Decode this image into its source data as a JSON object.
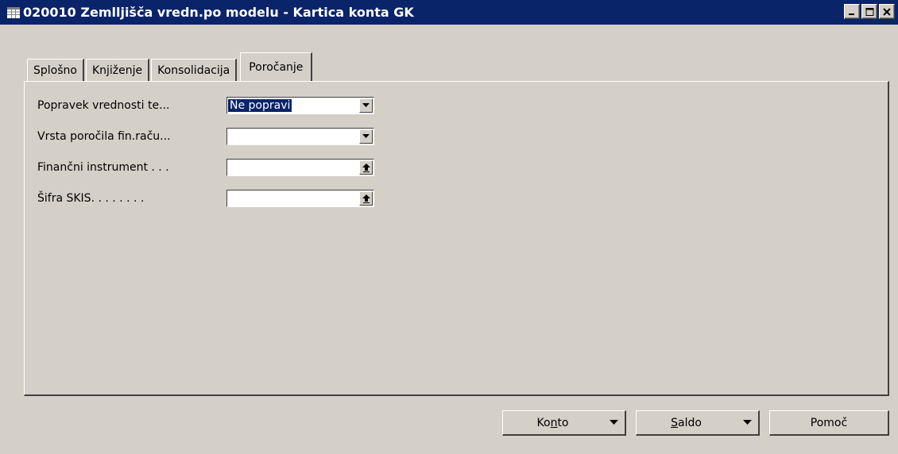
{
  "window": {
    "title": "020010 Zemlljišča vredn.po modelu - Kartica konta GK",
    "controls": [
      "minimize-icon",
      "maximize-icon",
      "close-icon"
    ]
  },
  "tabs": [
    {
      "label": "Splošno",
      "active": false
    },
    {
      "label": "Knjiženje",
      "active": false
    },
    {
      "label": "Konsolidacija",
      "active": false
    },
    {
      "label": "Poročanje",
      "active": true
    }
  ],
  "fields": [
    {
      "label": "Popravek vrednosti te...",
      "value": "Ne popravi",
      "control": "dropdown"
    },
    {
      "label": "Vrsta poročila fin.raču...",
      "value": "",
      "control": "dropdown"
    },
    {
      "label": "Finančni instrument . . .",
      "value": "",
      "control": "lookup"
    },
    {
      "label": "Šifra SKIS. . . . . . . .",
      "value": "",
      "control": "lookup"
    }
  ],
  "buttons": {
    "konto": {
      "pre": "Ko",
      "accel": "n",
      "post": "to"
    },
    "saldo": {
      "pre": "",
      "accel": "S",
      "post": "aldo"
    },
    "pomoc": {
      "label": "Pomoč"
    }
  },
  "colors": {
    "titlebar": "#0a246a",
    "face": "#d4d0c8",
    "selection": "#0a246a"
  }
}
